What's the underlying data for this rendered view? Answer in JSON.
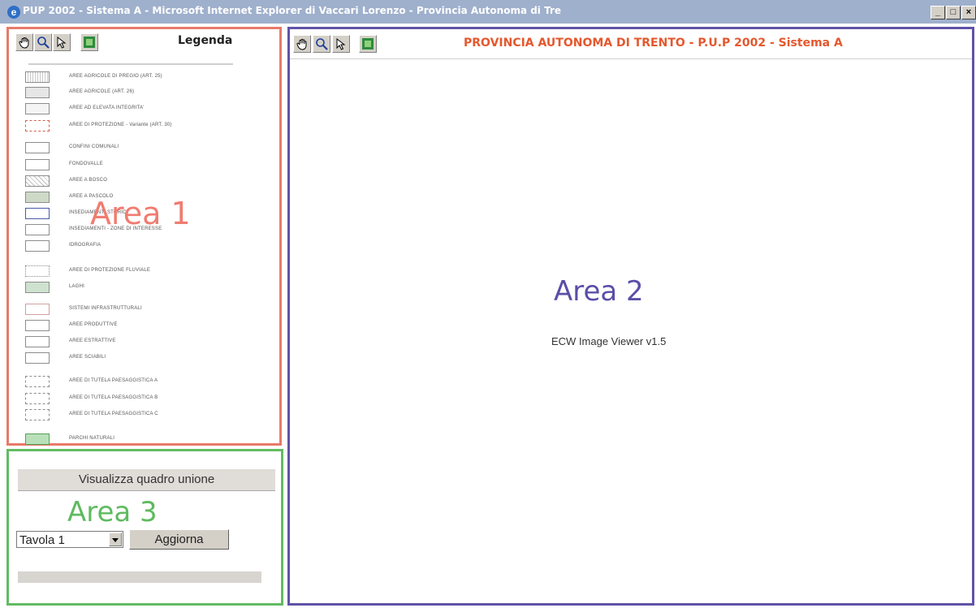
{
  "window": {
    "title": "PUP 2002 - Sistema A - Microsoft Internet Explorer di Vaccari Lorenzo - Provincia Autonoma di Tre",
    "buttons": [
      "_",
      "□",
      "×"
    ]
  },
  "area1": {
    "label": "Area 1",
    "legend_title": "Legenda",
    "tools": [
      "pan-hand-icon",
      "zoom-icon",
      "select-arrow-icon",
      "full-extent-icon"
    ],
    "legend_items": [
      {
        "text": "AREE AGRICOLE DI PREGIO (ART. 25)"
      },
      {
        "text": "AREE AGRICOLE (ART. 26)"
      },
      {
        "text": "AREE AD ELEVATA INTEGRITA'"
      },
      {
        "text": "AREE DI PROTEZIONE - Variante (ART. 30)"
      },
      {
        "text": "CONFINI COMUNALI"
      },
      {
        "text": "FONDOVALLE"
      },
      {
        "text": "AREE A BOSCO"
      },
      {
        "text": "AREE A PASCOLO"
      },
      {
        "text": "INSEDIAMENTI STORICI"
      },
      {
        "text": "INSEDIAMENTI - ZONE DI INTERESSE"
      },
      {
        "text": "IDROGRAFIA"
      },
      {
        "text": "AREE DI PROTEZIONE FLUVIALE"
      },
      {
        "text": "LAGHI"
      },
      {
        "text": "SISTEMI INFRASTRUTTURALI"
      },
      {
        "text": "AREE PRODUTTIVE"
      },
      {
        "text": "AREE ESTRATTIVE"
      },
      {
        "text": "AREE SCIABILI"
      },
      {
        "text": "AREE DI TUTELA PAESAGGISTICA A"
      },
      {
        "text": "AREE DI TUTELA PAESAGGISTICA B"
      },
      {
        "text": "AREE DI TUTELA PAESAGGISTICA C"
      },
      {
        "text": "PARCHI NATURALI"
      }
    ]
  },
  "area2": {
    "label": "Area 2",
    "title": "PROVINCIA AUTONOMA DI TRENTO - P.U.P 2002 - Sistema A",
    "viewer": "ECW Image Viewer v1.5",
    "tools": [
      "pan-hand-icon",
      "zoom-icon",
      "select-arrow-icon",
      "full-extent-icon"
    ]
  },
  "area3": {
    "label": "Area 3",
    "visualizza_button": "Visualizza quadro unione",
    "select_value": "Tavola 1",
    "aggiorna_button": "Aggiorna"
  },
  "colors": {
    "area1_border": "#e87a6a",
    "area2_border": "#6152a8",
    "area3_border": "#62bb62",
    "title_text": "#e4582e"
  }
}
